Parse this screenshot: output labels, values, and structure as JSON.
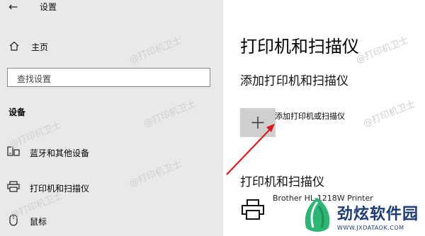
{
  "window": {
    "back_icon": "back-arrow-icon",
    "title": "设置"
  },
  "sidebar": {
    "home_label": "主页",
    "home_icon": "home-icon",
    "search_placeholder": "查找设置",
    "section_title": "设备",
    "items": [
      {
        "icon": "bluetooth-devices-icon",
        "label": "蓝牙和其他设备"
      },
      {
        "icon": "printer-icon",
        "label": "打印机和扫描仪"
      },
      {
        "icon": "mouse-icon",
        "label": "鼠标"
      }
    ]
  },
  "main": {
    "page_title": "打印机和扫描仪",
    "add_section_title": "添加打印机和扫描仪",
    "add_button_label": "添加打印机或扫描仪",
    "list_section_title": "打印机和扫描仪",
    "printer_name": "Brother HL-1218W Printer"
  },
  "overlay": {
    "watermark_text": "@打印机卫士",
    "arrow_color": "#e0191a",
    "logo_text": "劲炫软件园",
    "logo_url": "WWW.JXDATAOK.COM",
    "logo_color": "#1b3a78"
  }
}
